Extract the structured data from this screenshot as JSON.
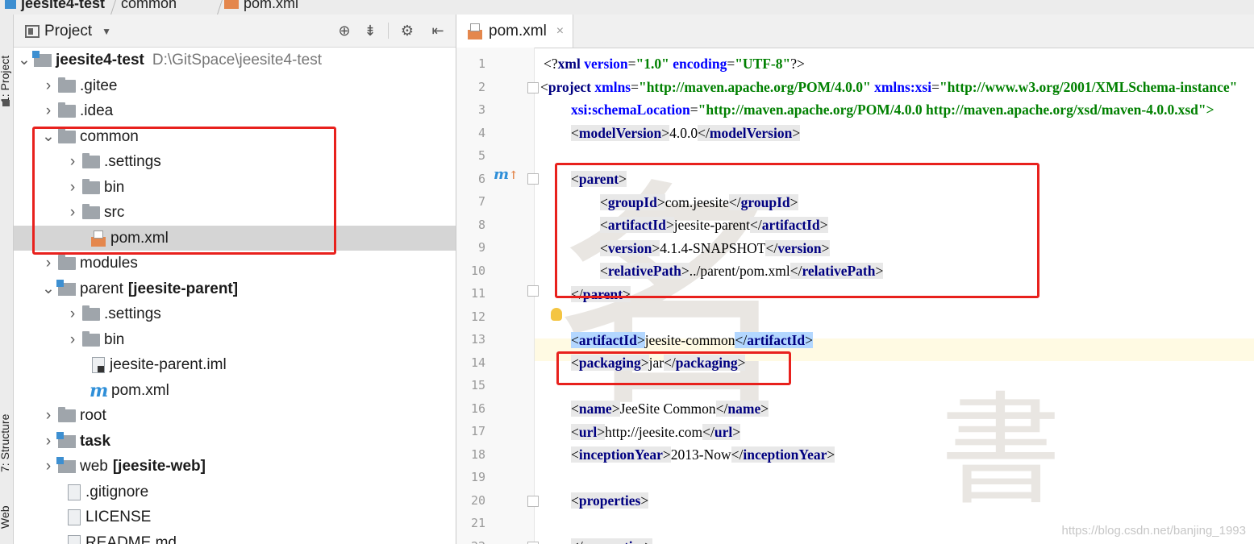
{
  "breadcrumb": [
    "jeesite4-test",
    "common",
    "pom.xml"
  ],
  "tool_stripe": [
    "1: Project",
    "7: Structure",
    "Web"
  ],
  "project_panel": {
    "title": "Project",
    "tree": [
      {
        "label": "jeesite4-test",
        "path": "D:\\GitSpace\\jeesite4-test",
        "bold": true
      },
      {
        "label": ".gitee"
      },
      {
        "label": ".idea"
      },
      {
        "label": "common"
      },
      {
        "label": ".settings"
      },
      {
        "label": "bin"
      },
      {
        "label": "src"
      },
      {
        "label": "pom.xml",
        "selected": true
      },
      {
        "label": "modules"
      },
      {
        "label": "parent",
        "module": "[jeesite-parent]"
      },
      {
        "label": ".settings"
      },
      {
        "label": "bin"
      },
      {
        "label": "jeesite-parent.iml"
      },
      {
        "label": "pom.xml"
      },
      {
        "label": "root"
      },
      {
        "label": "task"
      },
      {
        "label": "web",
        "module": "[jeesite-web]"
      },
      {
        "label": ".gitignore"
      },
      {
        "label": "LICENSE"
      },
      {
        "label": "README.md"
      }
    ]
  },
  "editor": {
    "tab_label": "pom.xml",
    "line_numbers": [
      "1",
      "2",
      "3",
      "4",
      "5",
      "6",
      "7",
      "8",
      "9",
      "10",
      "11",
      "12",
      "13",
      "14",
      "15",
      "16",
      "17",
      "18",
      "19",
      "20",
      "21",
      "22"
    ],
    "lines": {
      "l1": {
        "open": "<?",
        "name": "xml",
        "a1": " version",
        "eq1": "=",
        "v1": "\"1.0\"",
        "a2": " encoding",
        "eq2": "=",
        "v2": "\"UTF-8\"",
        "close": "?>"
      },
      "l2": {
        "open": "<",
        "name": "project",
        "a1": " xmlns",
        "eq1": "=",
        "v1": "\"http://maven.apache.org/POM/4.0.0\"",
        "a2": " xmlns:xsi",
        "eq2": "=",
        "v2": "\"http://www.w3.org/2001/XMLSchema-instance\""
      },
      "l3": {
        "a1": "xsi:schemaLocation",
        "eq1": "=",
        "v1": "\"http://maven.apache.org/POM/4.0.0 http://maven.apache.org/xsd/maven-4.0.0.xsd\">"
      },
      "l4": {
        "tag": "modelVersion",
        "text": "4.0.0"
      },
      "l6": {
        "tag": "parent"
      },
      "l7": {
        "tag": "groupId",
        "text": "com.jeesite"
      },
      "l8": {
        "tag": "artifactId",
        "text": "jeesite-parent"
      },
      "l9": {
        "tag": "version",
        "text": "4.1.4-SNAPSHOT"
      },
      "l10": {
        "tag": "relativePath",
        "text": "../parent/pom.xml"
      },
      "l11": {
        "tag": "parent"
      },
      "l13": {
        "tag": "artifactId",
        "text": "jeesite-common"
      },
      "l14": {
        "tag": "packaging",
        "text": "jar"
      },
      "l16": {
        "tag": "name",
        "text": "JeeSite Common"
      },
      "l17": {
        "tag": "url",
        "text": "http://jeesite.com"
      },
      "l18": {
        "tag": "inceptionYear",
        "text": "2013-Now"
      },
      "l20": {
        "tag": "properties"
      },
      "l22": {
        "tag": "properties"
      }
    }
  },
  "watermark": "https://blog.csdn.net/banjing_1993"
}
